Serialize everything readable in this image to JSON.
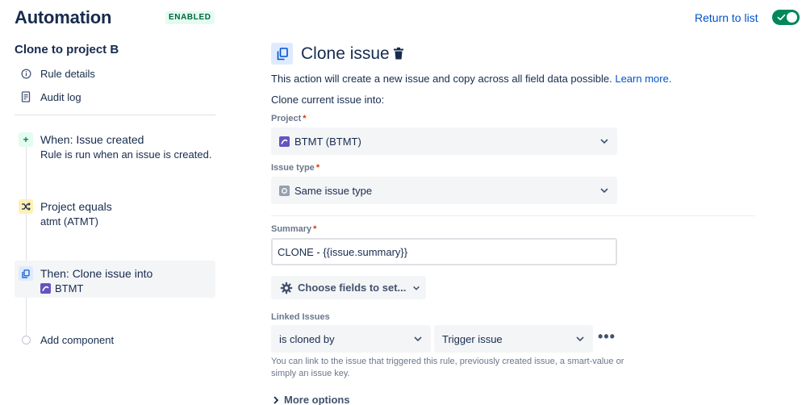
{
  "header": {
    "title": "Automation",
    "status_badge": "ENABLED",
    "return_link": "Return to list",
    "toggle_state": "on",
    "accent_color": "#00875a"
  },
  "sidebar": {
    "rule_name": "Clone to project B",
    "links": [
      {
        "label": "Rule details",
        "icon": "info-icon"
      },
      {
        "label": "Audit log",
        "icon": "document-icon"
      }
    ],
    "components": [
      {
        "type": "trigger",
        "icon": "plus-icon",
        "title": "When: Issue created",
        "subtitle": "Rule is run when an issue is created."
      },
      {
        "type": "condition",
        "icon": "shuffle-icon",
        "title": "Project equals",
        "subtitle": "atmt (ATMT)"
      },
      {
        "type": "action",
        "icon": "copy-icon",
        "title": "Then: Clone issue into",
        "subtitle": "BTMT",
        "selected": true
      }
    ],
    "add_component": "Add component"
  },
  "main": {
    "title": "Clone issue",
    "description": "This action will create a new issue and copy across all field data possible.",
    "learn_more": "Learn more.",
    "clone_into_label": "Clone current issue into:",
    "project": {
      "label": "Project",
      "value": "BTMT (BTMT)",
      "required": true
    },
    "issue_type": {
      "label": "Issue type",
      "value": "Same issue type",
      "required": true
    },
    "summary": {
      "label": "Summary",
      "value": "CLONE - {{issue.summary}}",
      "required": true
    },
    "choose_fields_label": "Choose fields to set...",
    "linked_issues": {
      "label": "Linked Issues",
      "link_type": "is cloned by",
      "target": "Trigger issue",
      "help": "You can link to the issue that triggered this rule, previously created issue, a smart-value or simply an issue key."
    },
    "more_options": "More options"
  }
}
